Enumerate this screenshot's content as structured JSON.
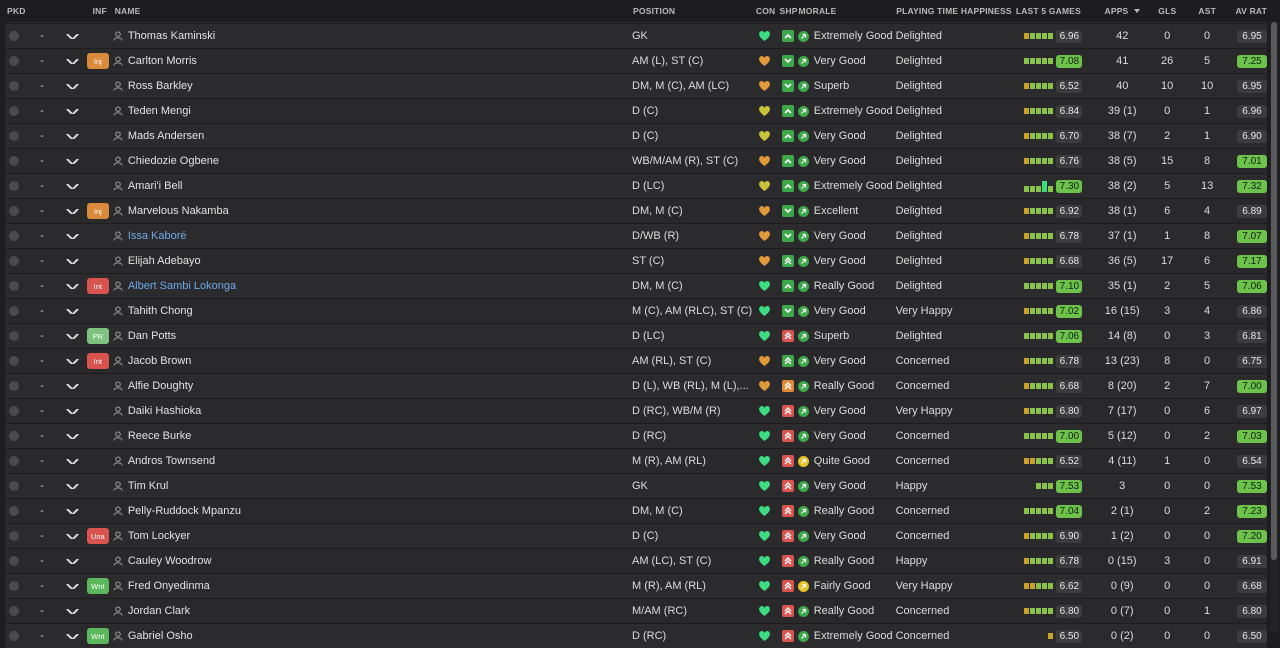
{
  "headers": {
    "pkd": "PKD",
    "inf": "INF",
    "name": "NAME",
    "position": "POSITION",
    "con": "CON",
    "shp": "SHP",
    "morale": "MORALE",
    "pth": "PLAYING TIME HAPPINESS",
    "last5": "LAST 5 GAMES",
    "apps": "APPS",
    "gls": "GLS",
    "ast": "AST",
    "avrat": "AV RAT"
  },
  "colors": {
    "heart_green": "#3ddc84",
    "heart_orange": "#e09a3a",
    "heart_yellow": "#c8c23a",
    "tag_inj": "#d98a3a",
    "tag_int": "#d9534f",
    "tag_pr": "#7fc27f",
    "tag_una": "#d9534f",
    "tag_wnt": "#5cb85c",
    "rating_high": "#6cc24a"
  },
  "rows": [
    {
      "sel": "-",
      "tag": "",
      "name": "Thomas Kaminski",
      "link": false,
      "position": "GK",
      "con": "green",
      "shp": "up-green",
      "morale_icon": "green",
      "morale": "Extremely Good",
      "pth": "Delighted",
      "bars": [
        "y",
        "g",
        "g",
        "g",
        "g"
      ],
      "last5": "6.96",
      "last5_hi": false,
      "apps": "42",
      "gls": "0",
      "ast": "0",
      "avrat": "6.95",
      "avr_hi": false
    },
    {
      "sel": "-",
      "tag": "Inj",
      "name": "Carlton Morris",
      "link": false,
      "position": "AM (L), ST (C)",
      "con": "orange",
      "shp": "down-green",
      "morale_icon": "green",
      "morale": "Very Good",
      "pth": "Delighted",
      "bars": [
        "g",
        "g",
        "g",
        "g",
        "g"
      ],
      "last5": "7.08",
      "last5_hi": true,
      "apps": "41",
      "gls": "26",
      "ast": "5",
      "avrat": "7.25",
      "avr_hi": true
    },
    {
      "sel": "-",
      "tag": "",
      "name": "Ross Barkley",
      "link": false,
      "position": "DM, M (C), AM (LC)",
      "con": "orange",
      "shp": "down-green",
      "morale_icon": "green",
      "morale": "Superb",
      "pth": "Delighted",
      "bars": [
        "y",
        "g",
        "g",
        "g",
        "g"
      ],
      "last5": "6.52",
      "last5_hi": false,
      "apps": "40",
      "gls": "10",
      "ast": "10",
      "avrat": "6.95",
      "avr_hi": false
    },
    {
      "sel": "-",
      "tag": "",
      "name": "Teden Mengi",
      "link": false,
      "position": "D (C)",
      "con": "yellow",
      "shp": "up-green",
      "morale_icon": "green",
      "morale": "Extremely Good",
      "pth": "Delighted",
      "bars": [
        "y",
        "g",
        "g",
        "g",
        "g"
      ],
      "last5": "6.84",
      "last5_hi": false,
      "apps": "39 (1)",
      "gls": "0",
      "ast": "1",
      "avrat": "6.96",
      "avr_hi": false
    },
    {
      "sel": "-",
      "tag": "",
      "name": "Mads Andersen",
      "link": false,
      "position": "D (C)",
      "con": "yellow",
      "shp": "up-green",
      "morale_icon": "green",
      "morale": "Very Good",
      "pth": "Delighted",
      "bars": [
        "y",
        "g",
        "g",
        "g",
        "g"
      ],
      "last5": "6.70",
      "last5_hi": false,
      "apps": "38 (7)",
      "gls": "2",
      "ast": "1",
      "avrat": "6.90",
      "avr_hi": false
    },
    {
      "sel": "-",
      "tag": "",
      "name": "Chiedozie Ogbene",
      "link": false,
      "position": "WB/M/AM (R), ST (C)",
      "con": "orange",
      "shp": "up-green",
      "morale_icon": "green",
      "morale": "Very Good",
      "pth": "Delighted",
      "bars": [
        "y",
        "g",
        "g",
        "g",
        "g"
      ],
      "last5": "6.76",
      "last5_hi": false,
      "apps": "38 (5)",
      "gls": "15",
      "ast": "8",
      "avrat": "7.01",
      "avr_hi": true
    },
    {
      "sel": "-",
      "tag": "",
      "name": "Amari'i Bell",
      "link": false,
      "position": "D (LC)",
      "con": "yellow",
      "shp": "up-green",
      "morale_icon": "green",
      "morale": "Extremely Good",
      "pth": "Delighted",
      "bars": [
        "g",
        "g",
        "g",
        "G",
        "g"
      ],
      "last5": "7.30",
      "last5_hi": true,
      "apps": "38 (2)",
      "gls": "5",
      "ast": "13",
      "avrat": "7.32",
      "avr_hi": true
    },
    {
      "sel": "-",
      "tag": "Inj",
      "name": "Marvelous Nakamba",
      "link": false,
      "position": "DM, M (C)",
      "con": "orange",
      "shp": "down-green",
      "morale_icon": "green",
      "morale": "Excellent",
      "pth": "Delighted",
      "bars": [
        "y",
        "g",
        "g",
        "g",
        "g"
      ],
      "last5": "6.92",
      "last5_hi": false,
      "apps": "38 (1)",
      "gls": "6",
      "ast": "4",
      "avrat": "6.89",
      "avr_hi": false
    },
    {
      "sel": "-",
      "tag": "",
      "name": "Issa Kaboré",
      "link": true,
      "position": "D/WB (R)",
      "con": "orange",
      "shp": "down-green",
      "morale_icon": "green",
      "morale": "Very Good",
      "pth": "Delighted",
      "bars": [
        "y",
        "g",
        "g",
        "g",
        "g"
      ],
      "last5": "6.78",
      "last5_hi": false,
      "apps": "37 (1)",
      "gls": "1",
      "ast": "8",
      "avrat": "7.07",
      "avr_hi": true
    },
    {
      "sel": "-",
      "tag": "",
      "name": "Elijah Adebayo",
      "link": false,
      "position": "ST (C)",
      "con": "orange",
      "shp": "upup-green",
      "morale_icon": "green",
      "morale": "Very Good",
      "pth": "Delighted",
      "bars": [
        "y",
        "g",
        "g",
        "g",
        "g"
      ],
      "last5": "6.68",
      "last5_hi": false,
      "apps": "36 (5)",
      "gls": "17",
      "ast": "6",
      "avrat": "7.17",
      "avr_hi": true
    },
    {
      "sel": "-",
      "tag": "Int",
      "name": "Albert Sambi Lokonga",
      "link": true,
      "position": "DM, M (C)",
      "con": "green",
      "shp": "up-green",
      "morale_icon": "green",
      "morale": "Really Good",
      "pth": "Delighted",
      "bars": [
        "g",
        "g",
        "g",
        "g",
        "g"
      ],
      "last5": "7.10",
      "last5_hi": true,
      "apps": "35 (1)",
      "gls": "2",
      "ast": "5",
      "avrat": "7.06",
      "avr_hi": true
    },
    {
      "sel": "-",
      "tag": "",
      "name": "Tahith Chong",
      "link": false,
      "position": "M (C), AM (RLC), ST (C)",
      "con": "green",
      "shp": "down-green",
      "morale_icon": "green",
      "morale": "Very Good",
      "pth": "Very Happy",
      "bars": [
        "y",
        "g",
        "g",
        "g",
        "g"
      ],
      "last5": "7.02",
      "last5_hi": true,
      "apps": "16 (15)",
      "gls": "3",
      "ast": "4",
      "avrat": "6.86",
      "avr_hi": false
    },
    {
      "sel": "-",
      "tag": "PR",
      "name": "Dan Potts",
      "link": false,
      "position": "D (LC)",
      "con": "green",
      "shp": "upup-red",
      "morale_icon": "green",
      "morale": "Superb",
      "pth": "Delighted",
      "bars": [
        "g",
        "g",
        "g",
        "g",
        "g"
      ],
      "last5": "7.06",
      "last5_hi": true,
      "apps": "14 (8)",
      "gls": "0",
      "ast": "3",
      "avrat": "6.81",
      "avr_hi": false
    },
    {
      "sel": "-",
      "tag": "Int",
      "name": "Jacob Brown",
      "link": false,
      "position": "AM (RL), ST (C)",
      "con": "orange",
      "shp": "upup-green",
      "morale_icon": "green",
      "morale": "Very Good",
      "pth": "Concerned",
      "bars": [
        "y",
        "g",
        "g",
        "g",
        "g"
      ],
      "last5": "6.78",
      "last5_hi": false,
      "apps": "13 (23)",
      "gls": "8",
      "ast": "0",
      "avrat": "6.75",
      "avr_hi": false
    },
    {
      "sel": "-",
      "tag": "",
      "name": "Alfie Doughty",
      "link": false,
      "position": "D (L), WB (RL), M (L),...",
      "con": "orange",
      "shp": "upup-orange",
      "morale_icon": "green",
      "morale": "Really Good",
      "pth": "Concerned",
      "bars": [
        "y",
        "g",
        "g",
        "g",
        "g"
      ],
      "last5": "6.68",
      "last5_hi": false,
      "apps": "8 (20)",
      "gls": "2",
      "ast": "7",
      "avrat": "7.00",
      "avr_hi": true
    },
    {
      "sel": "-",
      "tag": "",
      "name": "Daiki Hashioka",
      "link": false,
      "position": "D (RC), WB/M (R)",
      "con": "green",
      "shp": "upup-red",
      "morale_icon": "green",
      "morale": "Very Good",
      "pth": "Very Happy",
      "bars": [
        "y",
        "g",
        "g",
        "g",
        "g"
      ],
      "last5": "6.80",
      "last5_hi": false,
      "apps": "7 (17)",
      "gls": "0",
      "ast": "6",
      "avrat": "6.97",
      "avr_hi": false
    },
    {
      "sel": "-",
      "tag": "",
      "name": "Reece Burke",
      "link": false,
      "position": "D (RC)",
      "con": "green",
      "shp": "upup-red",
      "morale_icon": "green",
      "morale": "Very Good",
      "pth": "Concerned",
      "bars": [
        "g",
        "g",
        "g",
        "g",
        "g"
      ],
      "last5": "7.00",
      "last5_hi": true,
      "apps": "5 (12)",
      "gls": "0",
      "ast": "2",
      "avrat": "7.03",
      "avr_hi": true
    },
    {
      "sel": "-",
      "tag": "",
      "name": "Andros Townsend",
      "link": false,
      "position": "M (R), AM (RL)",
      "con": "green",
      "shp": "upup-red",
      "morale_icon": "yellow",
      "morale": "Quite Good",
      "pth": "Concerned",
      "bars": [
        "y",
        "y",
        "g",
        "g",
        "g"
      ],
      "last5": "6.52",
      "last5_hi": false,
      "apps": "4 (11)",
      "gls": "1",
      "ast": "0",
      "avrat": "6.54",
      "avr_hi": false
    },
    {
      "sel": "-",
      "tag": "",
      "name": "Tim Krul",
      "link": false,
      "position": "GK",
      "con": "green",
      "shp": "upup-red",
      "morale_icon": "green",
      "morale": "Very Good",
      "pth": "Happy",
      "bars": [
        "g",
        "g",
        "g"
      ],
      "last5": "7.53",
      "last5_hi": true,
      "apps": "3",
      "gls": "0",
      "ast": "0",
      "avrat": "7.53",
      "avr_hi": true
    },
    {
      "sel": "-",
      "tag": "",
      "name": "Pelly-Ruddock Mpanzu",
      "link": false,
      "position": "DM, M (C)",
      "con": "green",
      "shp": "upup-red",
      "morale_icon": "green",
      "morale": "Really Good",
      "pth": "Concerned",
      "bars": [
        "g",
        "g",
        "g",
        "g",
        "g"
      ],
      "last5": "7.04",
      "last5_hi": true,
      "apps": "2 (1)",
      "gls": "0",
      "ast": "2",
      "avrat": "7.23",
      "avr_hi": true
    },
    {
      "sel": "-",
      "tag": "Una",
      "name": "Tom Lockyer",
      "link": false,
      "position": "D (C)",
      "con": "green",
      "shp": "upup-red",
      "morale_icon": "green",
      "morale": "Very Good",
      "pth": "Concerned",
      "bars": [
        "y",
        "g",
        "g",
        "g",
        "g"
      ],
      "last5": "6.90",
      "last5_hi": false,
      "apps": "1 (2)",
      "gls": "0",
      "ast": "0",
      "avrat": "7.20",
      "avr_hi": true
    },
    {
      "sel": "-",
      "tag": "",
      "name": "Cauley Woodrow",
      "link": false,
      "position": "AM (LC), ST (C)",
      "con": "green",
      "shp": "upup-red",
      "morale_icon": "green",
      "morale": "Really Good",
      "pth": "Happy",
      "bars": [
        "y",
        "g",
        "g",
        "g",
        "g"
      ],
      "last5": "6.78",
      "last5_hi": false,
      "apps": "0 (15)",
      "gls": "3",
      "ast": "0",
      "avrat": "6.91",
      "avr_hi": false
    },
    {
      "sel": "-",
      "tag": "Wnt",
      "name": "Fred Onyedinma",
      "link": false,
      "position": "M (R), AM (RL)",
      "con": "green",
      "shp": "upup-red",
      "morale_icon": "yellow",
      "morale": "Fairly Good",
      "pth": "Very Happy",
      "bars": [
        "y",
        "y",
        "g",
        "g",
        "g"
      ],
      "last5": "6.62",
      "last5_hi": false,
      "apps": "0 (9)",
      "gls": "0",
      "ast": "0",
      "avrat": "6.68",
      "avr_hi": false
    },
    {
      "sel": "-",
      "tag": "",
      "name": "Jordan Clark",
      "link": false,
      "position": "M/AM (RC)",
      "con": "green",
      "shp": "upup-red",
      "morale_icon": "green",
      "morale": "Really Good",
      "pth": "Concerned",
      "bars": [
        "y",
        "g",
        "g",
        "g",
        "g"
      ],
      "last5": "6.80",
      "last5_hi": false,
      "apps": "0 (7)",
      "gls": "0",
      "ast": "1",
      "avrat": "6.80",
      "avr_hi": false
    },
    {
      "sel": "-",
      "tag": "Wnt",
      "name": "Gabriel Osho",
      "link": false,
      "position": "D (RC)",
      "con": "green",
      "shp": "upup-red",
      "morale_icon": "green",
      "morale": "Extremely Good",
      "pth": "Concerned",
      "bars": [
        "y"
      ],
      "last5": "6.50",
      "last5_hi": false,
      "apps": "0 (2)",
      "gls": "0",
      "ast": "0",
      "avrat": "6.50",
      "avr_hi": false
    }
  ]
}
